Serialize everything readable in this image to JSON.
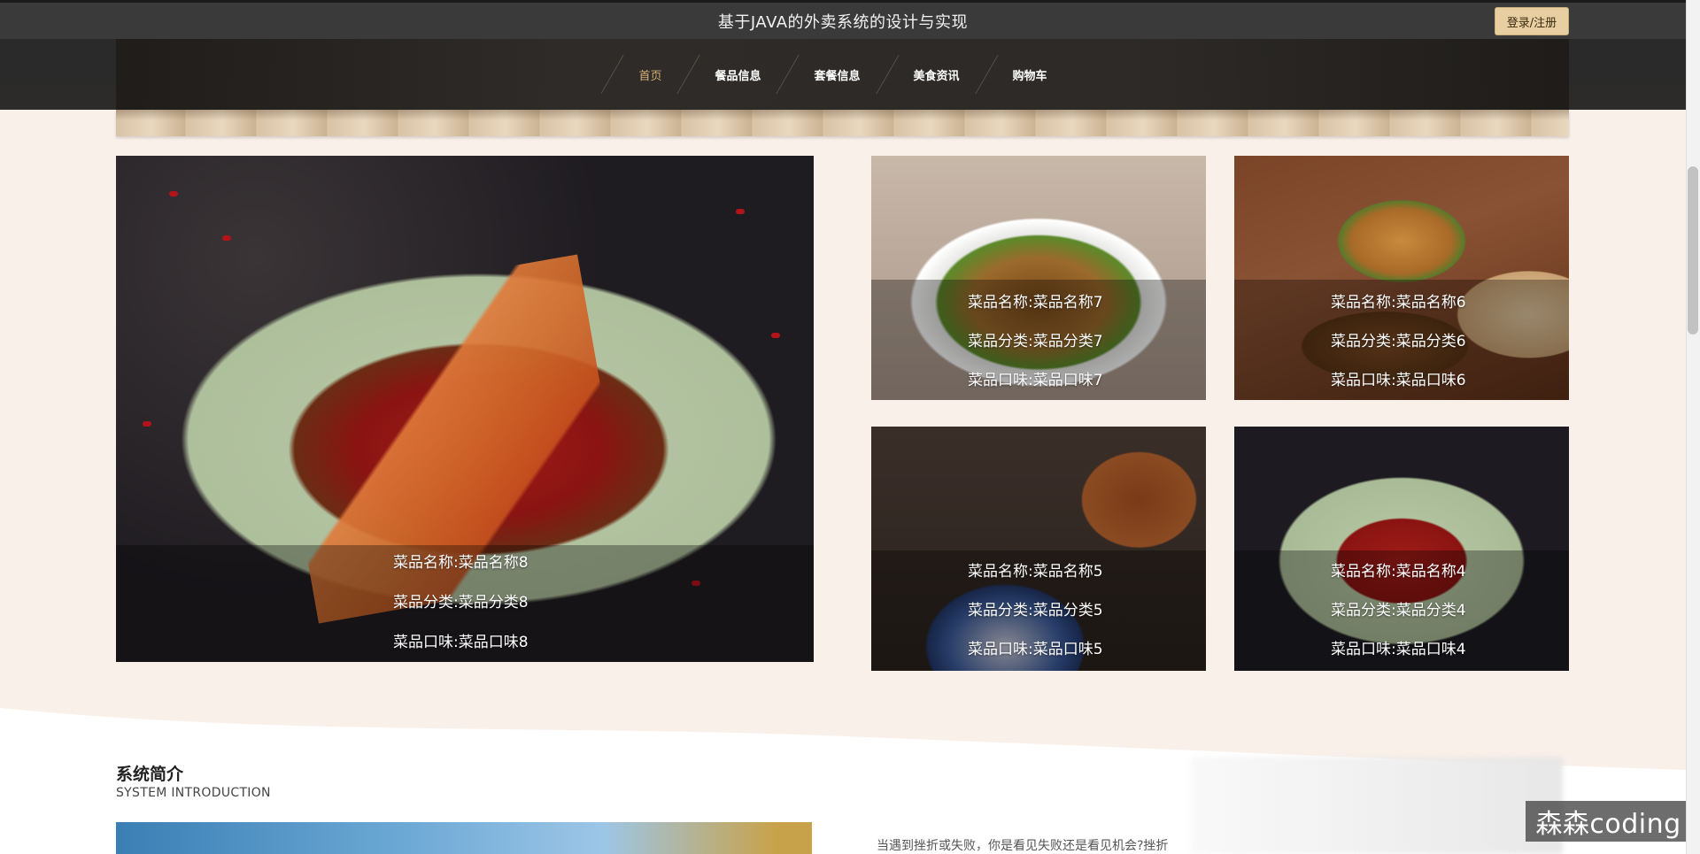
{
  "header": {
    "site_title": "基于JAVA的外卖系统的设计与实现",
    "login_label": "登录/注册"
  },
  "nav": {
    "items": [
      {
        "label": "首页",
        "active": true
      },
      {
        "label": "餐品信息",
        "active": false
      },
      {
        "label": "套餐信息",
        "active": false
      },
      {
        "label": "美食资讯",
        "active": false
      },
      {
        "label": "购物车",
        "active": false
      }
    ]
  },
  "dishes": [
    {
      "name": "菜品名称:菜品名称8",
      "category": "菜品分类:菜品分类8",
      "flavor": "菜品口味:菜品口味8"
    },
    {
      "name": "菜品名称:菜品名称7",
      "category": "菜品分类:菜品分类7",
      "flavor": "菜品口味:菜品口味7"
    },
    {
      "name": "菜品名称:菜品名称6",
      "category": "菜品分类:菜品分类6",
      "flavor": "菜品口味:菜品口味6"
    },
    {
      "name": "菜品名称:菜品名称5",
      "category": "菜品分类:菜品分类5",
      "flavor": "菜品口味:菜品口味5"
    },
    {
      "name": "菜品名称:菜品名称4",
      "category": "菜品分类:菜品分类4",
      "flavor": "菜品口味:菜品口味4"
    }
  ],
  "intro": {
    "title": "系统简介",
    "subtitle": "SYSTEM INTRODUCTION",
    "text": "当遇到挫折或失败，你是看见失败还是看见机会?挫折"
  },
  "watermark": "森森coding",
  "colors": {
    "accent": "#d6b27a",
    "login_bg": "#e7cfa1",
    "topbar_bg": "#3a3a3a",
    "page_bg": "#faf0ea"
  }
}
